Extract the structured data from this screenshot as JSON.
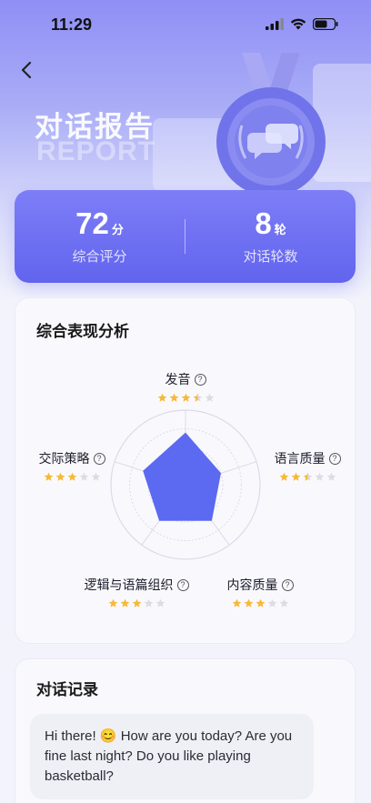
{
  "status_bar": {
    "time": "11:29"
  },
  "header": {
    "title_cn": "对话报告",
    "title_en": "REPORT"
  },
  "score_card": {
    "overall": {
      "value": "72",
      "unit": "分",
      "label": "综合评分"
    },
    "rounds": {
      "value": "8",
      "unit": "轮",
      "label": "对话轮数"
    }
  },
  "analysis": {
    "title": "综合表现分析",
    "dimensions": [
      {
        "label": "发音",
        "rating": 3.5
      },
      {
        "label": "语言质量",
        "rating": 2.5
      },
      {
        "label": "内容质量",
        "rating": 3
      },
      {
        "label": "逻辑与语篇组织",
        "rating": 3
      },
      {
        "label": "交际策略",
        "rating": 3
      }
    ],
    "max_rating": 5
  },
  "chat": {
    "title": "对话记录",
    "messages": [
      {
        "text": "Hi there! 😊 How are you today? Are you fine last night? Do you like playing basketball?"
      }
    ]
  },
  "colors": {
    "accent": "#6264ee",
    "radar_fill": "#5b6af0",
    "star_on": "#f6b93b",
    "star_off": "#dcdde3"
  }
}
